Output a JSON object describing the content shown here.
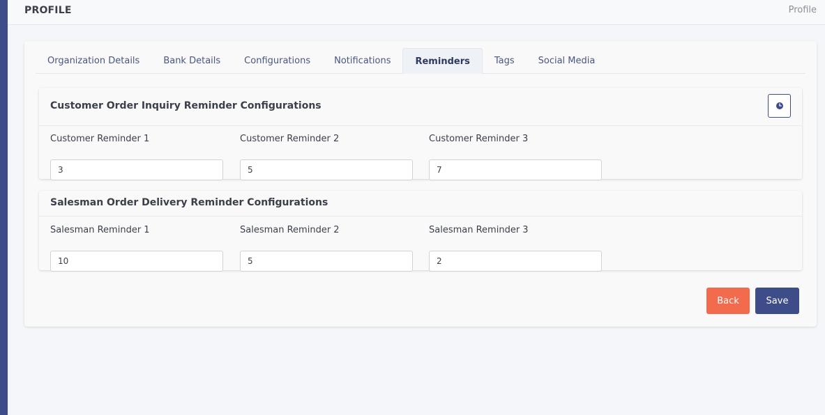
{
  "header": {
    "title": "PROFILE",
    "breadcrumb": "Profile"
  },
  "tabs": [
    {
      "label": "Organization Details",
      "active": false
    },
    {
      "label": "Bank Details",
      "active": false
    },
    {
      "label": "Configurations",
      "active": false
    },
    {
      "label": "Notifications",
      "active": false
    },
    {
      "label": "Reminders",
      "active": true
    },
    {
      "label": "Tags",
      "active": false
    },
    {
      "label": "Social Media",
      "active": false
    }
  ],
  "customer_section": {
    "title": "Customer Order Inquiry Reminder Configurations",
    "icon": "clock-icon",
    "fields": [
      {
        "label": "Customer Reminder 1",
        "value": "3"
      },
      {
        "label": "Customer Reminder 2",
        "value": "5"
      },
      {
        "label": "Customer Reminder 3",
        "value": "7"
      }
    ]
  },
  "salesman_section": {
    "title": "Salesman Order Delivery Reminder Configurations",
    "fields": [
      {
        "label": "Salesman Reminder 1",
        "value": "10"
      },
      {
        "label": "Salesman Reminder 2",
        "value": "5"
      },
      {
        "label": "Salesman Reminder 3",
        "value": "2"
      }
    ]
  },
  "actions": {
    "back_label": "Back",
    "save_label": "Save"
  },
  "colors": {
    "sidebar": "#3f4c8a",
    "primary": "#3f4c8a",
    "back": "#f26b4d"
  }
}
